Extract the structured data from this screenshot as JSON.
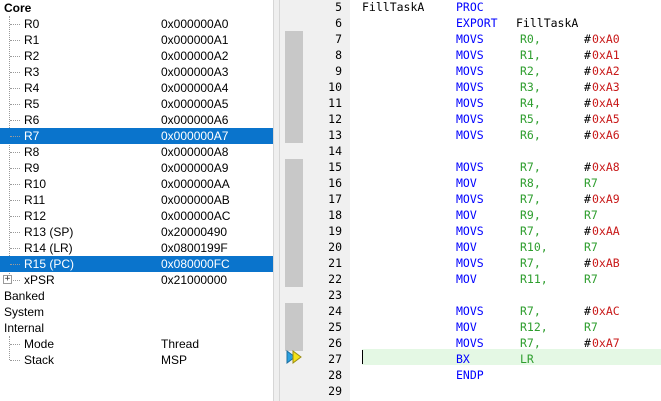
{
  "registers": {
    "tree": [
      {
        "label": "Core",
        "value": "",
        "level": 0,
        "bold": true
      },
      {
        "label": "R0",
        "value": "0x000000A0",
        "level": 1
      },
      {
        "label": "R1",
        "value": "0x000000A1",
        "level": 1
      },
      {
        "label": "R2",
        "value": "0x000000A2",
        "level": 1
      },
      {
        "label": "R3",
        "value": "0x000000A3",
        "level": 1
      },
      {
        "label": "R4",
        "value": "0x000000A4",
        "level": 1
      },
      {
        "label": "R5",
        "value": "0x000000A5",
        "level": 1
      },
      {
        "label": "R6",
        "value": "0x000000A6",
        "level": 1
      },
      {
        "label": "R7",
        "value": "0x000000A7",
        "level": 1,
        "selected": true
      },
      {
        "label": "R8",
        "value": "0x000000A8",
        "level": 1
      },
      {
        "label": "R9",
        "value": "0x000000A9",
        "level": 1
      },
      {
        "label": "R10",
        "value": "0x000000AA",
        "level": 1
      },
      {
        "label": "R11",
        "value": "0x000000AB",
        "level": 1
      },
      {
        "label": "R12",
        "value": "0x000000AC",
        "level": 1
      },
      {
        "label": "R13 (SP)",
        "value": "0x20000490",
        "level": 1
      },
      {
        "label": "R14 (LR)",
        "value": "0x0800199F",
        "level": 1
      },
      {
        "label": "R15 (PC)",
        "value": "0x080000FC",
        "level": 1,
        "selected": true
      },
      {
        "label": "xPSR",
        "value": "0x21000000",
        "level": 1,
        "expandable": true
      },
      {
        "label": "Banked",
        "value": "",
        "level": 0
      },
      {
        "label": "System",
        "value": "",
        "level": 0
      },
      {
        "label": "Internal",
        "value": "",
        "level": 0
      },
      {
        "label": "Mode",
        "value": "Thread",
        "level": 1
      },
      {
        "label": "Stack",
        "value": "MSP",
        "level": 1
      }
    ]
  },
  "editor": {
    "current_line": 27,
    "breakpoint_lines": [
      7,
      8,
      9,
      10,
      11,
      12,
      13,
      15,
      16,
      17,
      18,
      19,
      20,
      21,
      22,
      24,
      25,
      26
    ],
    "lines": [
      {
        "num": "5",
        "tokens": [
          [
            "FillTaskA",
            "txt",
            0
          ],
          [
            "PROC",
            "kw",
            94
          ]
        ]
      },
      {
        "num": "6",
        "tokens": [
          [
            "EXPORT",
            "kw",
            94
          ],
          [
            "FillTaskA",
            "txt",
            154
          ]
        ]
      },
      {
        "num": "7",
        "tokens": [
          [
            "MOVS",
            "kw",
            94
          ],
          [
            "R0,",
            "reg",
            158
          ],
          [
            "#",
            "txt",
            222
          ],
          [
            "0xA0",
            "imm",
            230
          ]
        ]
      },
      {
        "num": "8",
        "tokens": [
          [
            "MOVS",
            "kw",
            94
          ],
          [
            "R1,",
            "reg",
            158
          ],
          [
            "#",
            "txt",
            222
          ],
          [
            "0xA1",
            "imm",
            230
          ]
        ]
      },
      {
        "num": "9",
        "tokens": [
          [
            "MOVS",
            "kw",
            94
          ],
          [
            "R2,",
            "reg",
            158
          ],
          [
            "#",
            "txt",
            222
          ],
          [
            "0xA2",
            "imm",
            230
          ]
        ]
      },
      {
        "num": "10",
        "tokens": [
          [
            "MOVS",
            "kw",
            94
          ],
          [
            "R3,",
            "reg",
            158
          ],
          [
            "#",
            "txt",
            222
          ],
          [
            "0xA3",
            "imm",
            230
          ]
        ]
      },
      {
        "num": "11",
        "tokens": [
          [
            "MOVS",
            "kw",
            94
          ],
          [
            "R4,",
            "reg",
            158
          ],
          [
            "#",
            "txt",
            222
          ],
          [
            "0xA4",
            "imm",
            230
          ]
        ]
      },
      {
        "num": "12",
        "tokens": [
          [
            "MOVS",
            "kw",
            94
          ],
          [
            "R5,",
            "reg",
            158
          ],
          [
            "#",
            "txt",
            222
          ],
          [
            "0xA5",
            "imm",
            230
          ]
        ]
      },
      {
        "num": "13",
        "tokens": [
          [
            "MOVS",
            "kw",
            94
          ],
          [
            "R6,",
            "reg",
            158
          ],
          [
            "#",
            "txt",
            222
          ],
          [
            "0xA6",
            "imm",
            230
          ]
        ]
      },
      {
        "num": "14",
        "tokens": []
      },
      {
        "num": "15",
        "tokens": [
          [
            "MOVS",
            "kw",
            94
          ],
          [
            "R7,",
            "reg",
            158
          ],
          [
            "#",
            "txt",
            222
          ],
          [
            "0xA8",
            "imm",
            230
          ]
        ]
      },
      {
        "num": "16",
        "tokens": [
          [
            "MOV",
            "kw",
            94
          ],
          [
            "R8,",
            "reg",
            158
          ],
          [
            "R7",
            "reg",
            222
          ]
        ]
      },
      {
        "num": "17",
        "tokens": [
          [
            "MOVS",
            "kw",
            94
          ],
          [
            "R7,",
            "reg",
            158
          ],
          [
            "#",
            "txt",
            222
          ],
          [
            "0xA9",
            "imm",
            230
          ]
        ]
      },
      {
        "num": "18",
        "tokens": [
          [
            "MOV",
            "kw",
            94
          ],
          [
            "R9,",
            "reg",
            158
          ],
          [
            "R7",
            "reg",
            222
          ]
        ]
      },
      {
        "num": "19",
        "tokens": [
          [
            "MOVS",
            "kw",
            94
          ],
          [
            "R7,",
            "reg",
            158
          ],
          [
            "#",
            "txt",
            222
          ],
          [
            "0xAA",
            "imm",
            230
          ]
        ]
      },
      {
        "num": "20",
        "tokens": [
          [
            "MOV",
            "kw",
            94
          ],
          [
            "R10,",
            "reg",
            158
          ],
          [
            "R7",
            "reg",
            222
          ]
        ]
      },
      {
        "num": "21",
        "tokens": [
          [
            "MOVS",
            "kw",
            94
          ],
          [
            "R7,",
            "reg",
            158
          ],
          [
            "#",
            "txt",
            222
          ],
          [
            "0xAB",
            "imm",
            230
          ]
        ]
      },
      {
        "num": "22",
        "tokens": [
          [
            "MOV",
            "kw",
            94
          ],
          [
            "R11,",
            "reg",
            158
          ],
          [
            "R7",
            "reg",
            222
          ]
        ]
      },
      {
        "num": "23",
        "tokens": []
      },
      {
        "num": "24",
        "tokens": [
          [
            "MOVS",
            "kw",
            94
          ],
          [
            "R7,",
            "reg",
            158
          ],
          [
            "#",
            "txt",
            222
          ],
          [
            "0xAC",
            "imm",
            230
          ]
        ]
      },
      {
        "num": "25",
        "tokens": [
          [
            "MOV",
            "kw",
            94
          ],
          [
            "R12,",
            "reg",
            158
          ],
          [
            "R7",
            "reg",
            222
          ]
        ]
      },
      {
        "num": "26",
        "tokens": [
          [
            "MOVS",
            "kw",
            94
          ],
          [
            "R7,",
            "reg",
            158
          ],
          [
            "#",
            "txt",
            222
          ],
          [
            "0xA7",
            "imm",
            230
          ]
        ]
      },
      {
        "num": "27",
        "tokens": [
          [
            "BX",
            "kw",
            94
          ],
          [
            "LR",
            "reg",
            158
          ]
        ]
      },
      {
        "num": "28",
        "tokens": [
          [
            "ENDP",
            "kw",
            94
          ]
        ]
      },
      {
        "num": "29",
        "tokens": []
      }
    ]
  },
  "colors": {
    "selection": "#0a74cc",
    "keyword": "#0000ff",
    "register": "#2e9e2e",
    "immediate": "#c81818",
    "current_line": "#e4f8e4"
  },
  "icons": {
    "expand": "plus-box-icon",
    "execution_pointer": "current-instruction-arrow-icon"
  }
}
